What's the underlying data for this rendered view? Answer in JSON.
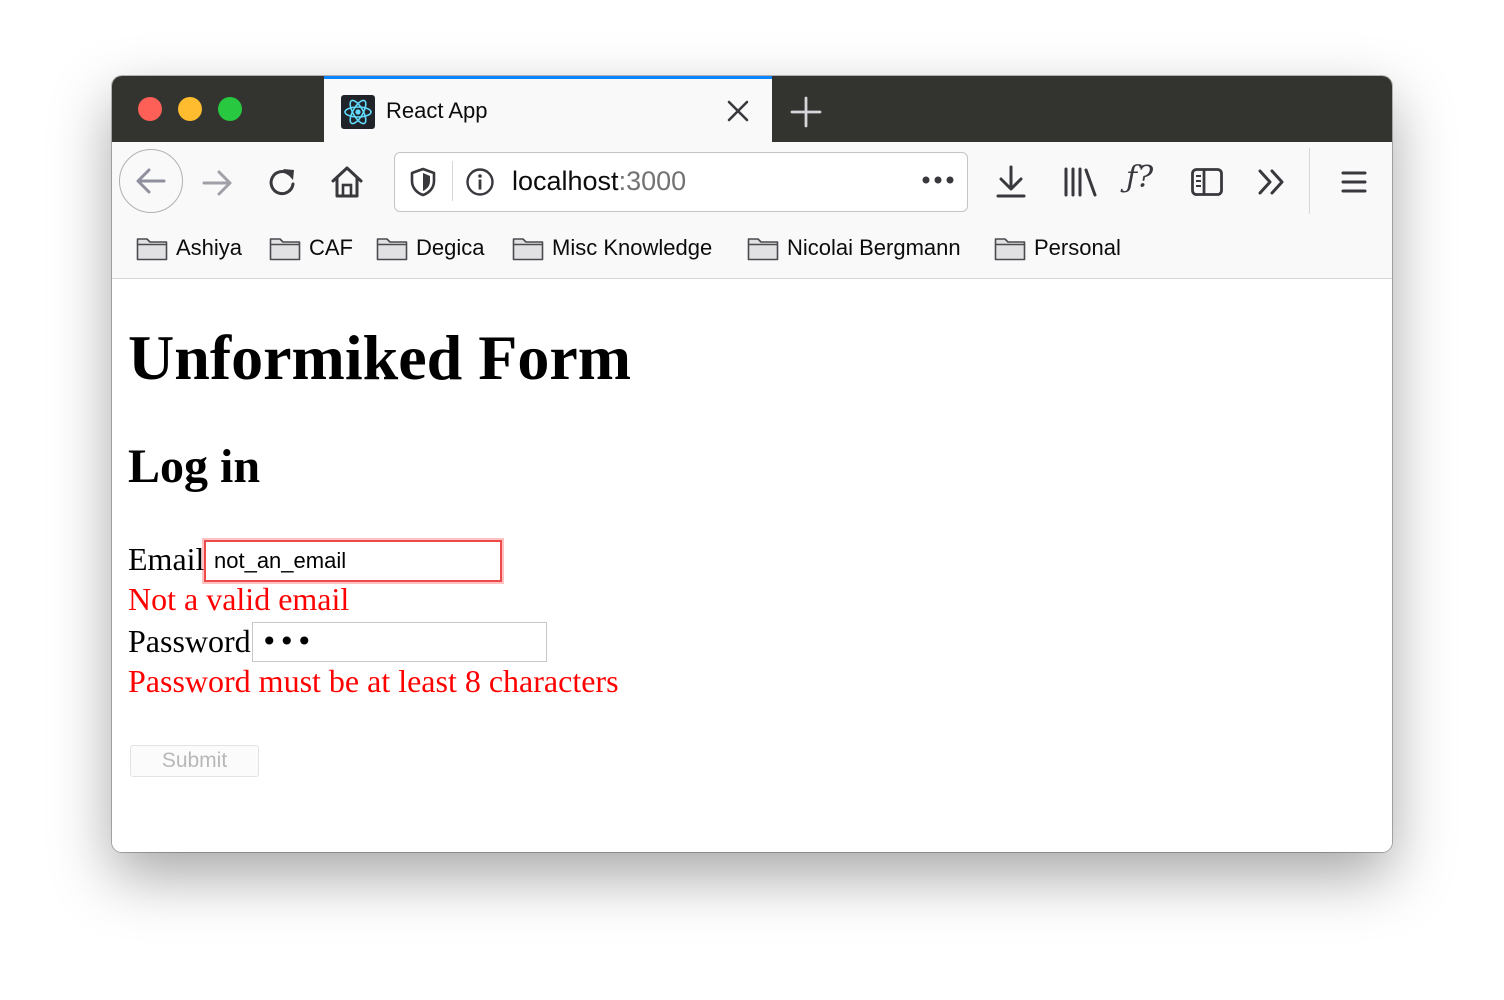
{
  "browser": {
    "tab": {
      "title": "React App",
      "favicon": "react-logo-icon"
    },
    "url": {
      "host": "localhost",
      "port": ":3000"
    },
    "toolbar_icons": [
      "back-icon",
      "forward-icon",
      "reload-icon",
      "home-icon",
      "shield-icon",
      "info-icon",
      "page-actions-icon",
      "download-icon",
      "library-icon",
      "function-icon",
      "sidebar-icon",
      "overflow-icon",
      "menu-icon"
    ],
    "accent_color": "#0a84ff"
  },
  "bookmarks": [
    {
      "label": "Ashiya"
    },
    {
      "label": "CAF"
    },
    {
      "label": "Degica"
    },
    {
      "label": "Misc Knowledge"
    },
    {
      "label": "Nicolai Bergmann"
    },
    {
      "label": "Personal"
    }
  ],
  "page": {
    "title": "Unformiked Form",
    "subtitle": "Log in",
    "email": {
      "label": "Email",
      "value": "not_an_email",
      "error": "Not a valid email"
    },
    "password": {
      "label": "Password",
      "masked_value": "•••",
      "error": "Password must be at least 8 characters"
    },
    "submit_label": "Submit",
    "error_color": "#ff0000"
  }
}
